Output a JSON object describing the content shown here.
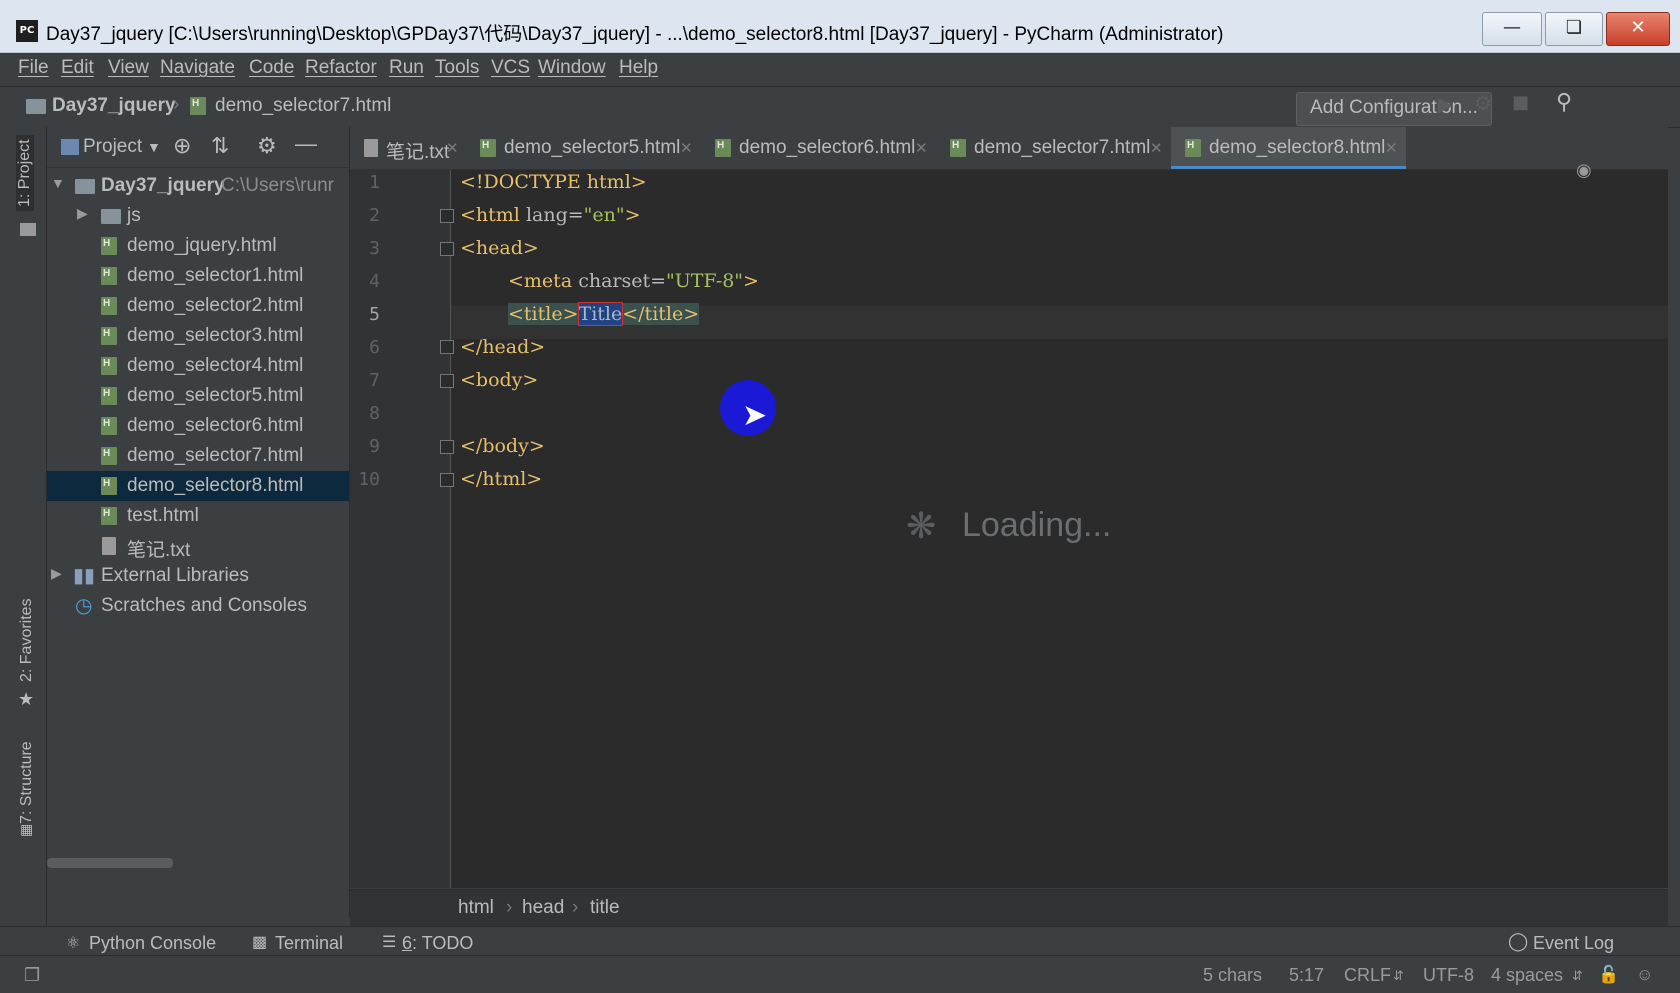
{
  "window": {
    "title": "Day37_jquery [C:\\Users\\running\\Desktop\\GPDay37\\代码\\Day37_jquery] - ...\\demo_selector8.html [Day37_jquery] - PyCharm (Administrator)",
    "app_icon_text": "PC"
  },
  "menu": [
    "File",
    "Edit",
    "View",
    "Navigate",
    "Code",
    "Refactor",
    "Run",
    "Tools",
    "VCS",
    "Window",
    "Help"
  ],
  "navbar": {
    "project": "Day37_jquery",
    "file": "demo_selector7.html",
    "add_configuration": "Add Configuration..."
  },
  "left_strip": {
    "project_tab": "1: Project",
    "favorites_tab": "2: Favorites",
    "structure_tab": "7: Structure"
  },
  "project_panel": {
    "header": "Project",
    "root": {
      "name": "Day37_jquery",
      "path": "C:\\Users\\runr"
    },
    "items": [
      {
        "name": "js",
        "type": "folder"
      },
      {
        "name": "demo_jquery.html",
        "type": "html"
      },
      {
        "name": "demo_selector1.html",
        "type": "html"
      },
      {
        "name": "demo_selector2.html",
        "type": "html"
      },
      {
        "name": "demo_selector3.html",
        "type": "html"
      },
      {
        "name": "demo_selector4.html",
        "type": "html"
      },
      {
        "name": "demo_selector5.html",
        "type": "html"
      },
      {
        "name": "demo_selector6.html",
        "type": "html"
      },
      {
        "name": "demo_selector7.html",
        "type": "html"
      },
      {
        "name": "demo_selector8.html",
        "type": "html",
        "selected": true
      },
      {
        "name": "test.html",
        "type": "html"
      },
      {
        "name": "笔记.txt",
        "type": "txt"
      }
    ],
    "external_libraries": "External Libraries",
    "scratches": "Scratches and Consoles"
  },
  "tabs": [
    {
      "label": "笔记.txt",
      "active": false
    },
    {
      "label": "demo_selector5.html",
      "active": false
    },
    {
      "label": "demo_selector6.html",
      "active": false
    },
    {
      "label": "demo_selector7.html",
      "active": false
    },
    {
      "label": "demo_selector8.html",
      "active": true
    }
  ],
  "editor": {
    "line_numbers": [
      "1",
      "2",
      "3",
      "4",
      "5",
      "6",
      "7",
      "8",
      "9",
      "10"
    ],
    "current_line": "5",
    "code": {
      "l1": "<!DOCTYPE html>",
      "l2_open": "<html ",
      "l2_attr": "lang=",
      "l2_val": "\"en\"",
      "l2_close": ">",
      "l3": "<head>",
      "l4_open": "<meta ",
      "l4_attr": "charset=",
      "l4_val": "\"UTF-8\"",
      "l4_close": ">",
      "l5_open": "<title>",
      "l5_text": "Title",
      "l5_close": "</title>",
      "l6": "</head>",
      "l7": "<body>",
      "l9": "</body>",
      "l10": "</html>"
    },
    "loading_text": "Loading..."
  },
  "breadcrumb": [
    "html",
    "head",
    "title"
  ],
  "tool_windows": {
    "python_console": "Python Console",
    "terminal": "Terminal",
    "todo_num": "6",
    "todo": ": TODO",
    "event_log": "Event Log"
  },
  "status": {
    "chars": "5 chars",
    "position": "5:17",
    "line_sep": "CRLF",
    "encoding": "UTF-8",
    "indent": "4 spaces"
  },
  "colors": {
    "tag": "#e8bf6a",
    "attr_value": "#a5c25c",
    "selection": "#214283",
    "accent": "#4a88c7"
  }
}
